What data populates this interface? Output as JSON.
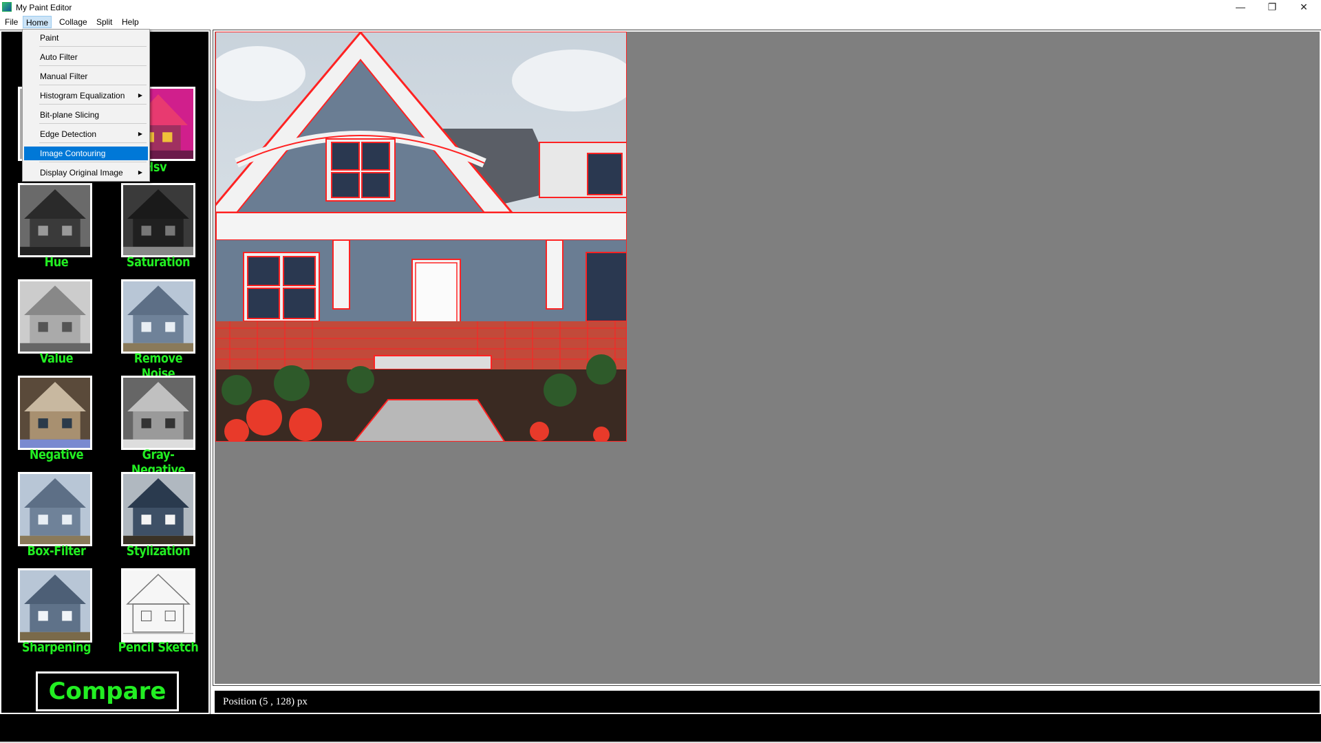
{
  "window": {
    "title": "My Paint Editor",
    "minimize_glyph": "—",
    "maximize_glyph": "❐",
    "close_glyph": "✕"
  },
  "menubar": {
    "items": [
      "File",
      "Home",
      "Collage",
      "Split",
      "Help"
    ],
    "active": "Home"
  },
  "home_menu": {
    "items": [
      {
        "label": "Paint",
        "submenu": false
      },
      {
        "label": "Auto Filter",
        "submenu": false
      },
      {
        "label": "Manual Filter",
        "submenu": false
      },
      {
        "label": "Histogram Equalization",
        "submenu": true
      },
      {
        "label": "Bit-plane Slicing",
        "submenu": false
      },
      {
        "label": "Edge Detection",
        "submenu": true
      },
      {
        "label": "Image Contouring",
        "submenu": false
      },
      {
        "label": "Display Original Image",
        "submenu": true
      }
    ],
    "highlighted": "Image Contouring",
    "submenu_arrow": "▶"
  },
  "sidebar": {
    "filters": [
      {
        "label": "Hsv",
        "thumb": "hsv"
      },
      {
        "label": "Hue",
        "thumb": "hue"
      },
      {
        "label": "Saturation",
        "thumb": "saturation"
      },
      {
        "label": "Value",
        "thumb": "value"
      },
      {
        "label": "Remove Noise",
        "thumb": "color"
      },
      {
        "label": "Negative",
        "thumb": "negative"
      },
      {
        "label": "Gray-Negative",
        "thumb": "gray-negative"
      },
      {
        "label": "Box-Filter",
        "thumb": "color"
      },
      {
        "label": "Stylization",
        "thumb": "stylization"
      },
      {
        "label": "Sharpening",
        "thumb": "color"
      },
      {
        "label": "Pencil Sketch",
        "thumb": "sketch"
      }
    ],
    "compare_label": "Compare"
  },
  "status": {
    "text": "Position (5 , 128) px"
  },
  "colors": {
    "label_green": "#22ee22",
    "contour_red": "#ff2020",
    "canvas_gray": "#7f7f7f",
    "highlight_blue": "#0078d7"
  }
}
